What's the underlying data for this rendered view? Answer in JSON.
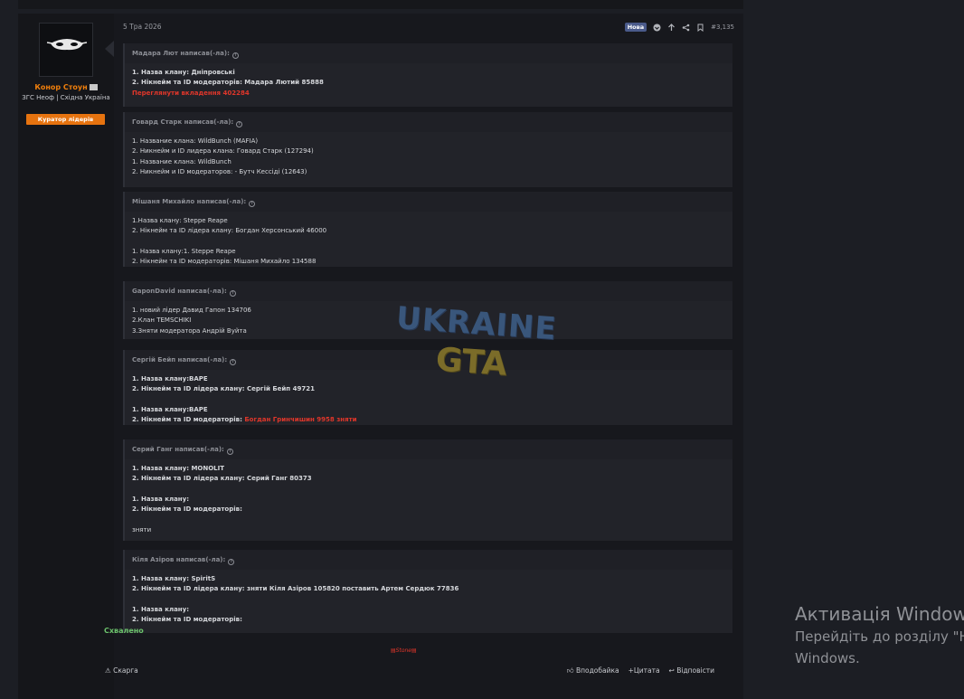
{
  "post": {
    "date": "5 Тра 2026",
    "new_badge": "Нова",
    "number": "#3,135",
    "icons": [
      "reaction-icon",
      "upvote-icon",
      "share-icon",
      "bookmark-icon"
    ]
  },
  "user": {
    "name": "Конор Стоун",
    "title": "ЗГС Неоф | Східна Україна",
    "badge": "Куратор лідерів",
    "avatar_icon": "masked-face-icon"
  },
  "quotes": [
    {
      "author": "Мадара Лют написав(-ла):",
      "lines": [
        {
          "text": "1. Назва клану: Дніпровські",
          "bold": true
        },
        {
          "text": "2. Нікнейм та ID модераторів: Мадара Лютий 85888",
          "bold": true
        },
        {
          "text": "Переглянути вкладення 402284",
          "red": true
        }
      ]
    },
    {
      "author": "Говард Старк написав(-ла):",
      "lines": [
        {
          "text": "1. Название клана: WildBunch (MAFIA)"
        },
        {
          "text": "2. Никнейм и ID лидера клана: Говард Старк (127294)"
        },
        {
          "text": "1. Название клана: WildBunch"
        },
        {
          "text": "2. Никнейм и ID модераторов: - Бутч Кессіді (12643)"
        }
      ]
    },
    {
      "author": "Мішаня Михайло написав(-ла):",
      "lines": [
        {
          "text": "1.Назва клану: Steppe Reape"
        },
        {
          "text": "2. Нікнейм та ID лідера клану: Богдан Херсонський 46000"
        },
        {
          "text": ""
        },
        {
          "text": "1. Назва клану:1. Steppe Reape"
        },
        {
          "text": "2. Нікнейм та ID модераторів: Мішаня Михайло 134588"
        }
      ]
    },
    {
      "author": "GaponDavid написав(-ла):",
      "lines": [
        {
          "text": "1. новий лідер Давид Гапон 134706"
        },
        {
          "text": "2.Клан TEMSCHIKI"
        },
        {
          "text": "3.Зняти модератора Андрій Вуйта"
        }
      ]
    },
    {
      "author": "Сергій Бейп написав(-ла):",
      "lines": [
        {
          "text": "1. Назва клану:BAPE",
          "bold": true
        },
        {
          "text": "2. Нікнейм та ID лідера клану: Сергій Бейп 49721",
          "bold": true
        },
        {
          "text": ""
        },
        {
          "text": "1. Назва клану:BAPE",
          "bold": true
        },
        {
          "text": "2. Нікнейм та ID модераторів: ",
          "bold": true,
          "red_tail": "Богдан Гринчишин 9958 зняти"
        }
      ]
    },
    {
      "author": "Серий Ганг написав(-ла):",
      "lines": [
        {
          "text": "1. Назва клану: MONOLIT",
          "bold": true
        },
        {
          "text": "2. Нікнейм та ID лідера клану: Серий Ганг 80373",
          "bold": true
        },
        {
          "text": ""
        },
        {
          "text": "1. Назва клану:",
          "bold": true
        },
        {
          "text": "2. Нікнейм та ID модераторів:",
          "bold": true
        },
        {
          "text": ""
        },
        {
          "text": "зняти"
        }
      ]
    },
    {
      "author": "Кіля Азіров написав(-ла):",
      "lines": [
        {
          "text": "1. Назва клану: SpiritS",
          "bold": true
        },
        {
          "text": "2. Нікнейм та ID лідера клану: зняти Кіля Азіров 105820 поставить Артем Сердюк 77836",
          "bold": true
        },
        {
          "text": ""
        },
        {
          "text": "1. Назва клану:",
          "bold": true
        },
        {
          "text": "2. Нікнейм та ID модераторів:",
          "bold": true
        }
      ]
    }
  ],
  "approved": "Схвалено",
  "signature": "Stone",
  "footer": {
    "report": "Скарга",
    "like": "Вподобайка",
    "quote": "+Цитата",
    "reply": "Відповісти"
  },
  "watermark": {
    "line1": "UKRAINE",
    "line2": "GTA"
  },
  "windows": {
    "title": "Активація Windows",
    "line1": "Перейдіть до розділу \"Настройки\", щоб активувати",
    "line2": "Windows."
  }
}
